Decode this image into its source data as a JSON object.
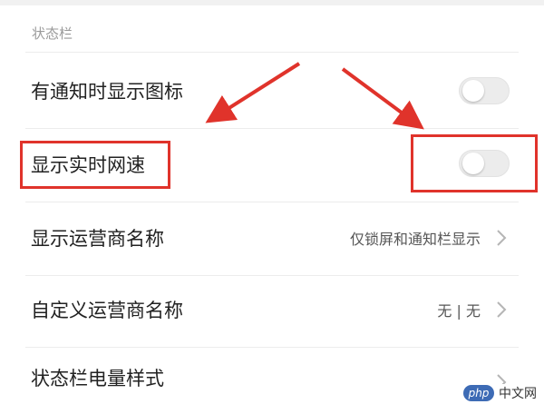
{
  "section": {
    "title": "状态栏"
  },
  "rows": [
    {
      "label": "有通知时显示图标",
      "control": "toggle",
      "on": false
    },
    {
      "label": "显示实时网速",
      "control": "toggle",
      "on": false
    },
    {
      "label": "显示运营商名称",
      "value": "仅锁屏和通知栏显示",
      "control": "chevron"
    },
    {
      "label": "自定义运营商名称",
      "value": "无 | 无",
      "control": "chevron"
    },
    {
      "label": "状态栏电量样式",
      "control": "chevron"
    }
  ],
  "colors": {
    "annotation": "#e0332b",
    "toggle_off": "#ececec",
    "watermark_logo": "#3d6bb5"
  },
  "watermark": {
    "logo": "php",
    "site": "中文网"
  }
}
